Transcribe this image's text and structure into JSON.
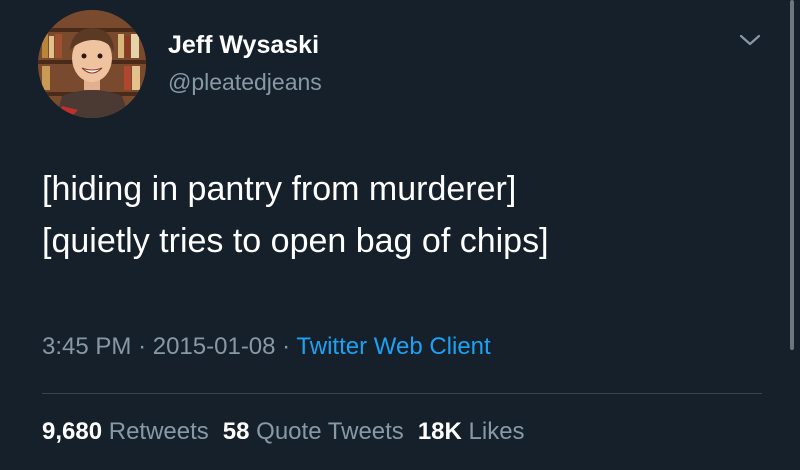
{
  "author": {
    "name": "Jeff Wysaski",
    "handle": "@pleatedjeans"
  },
  "tweet": {
    "lines": [
      "[hiding in pantry from murderer]",
      "[quietly tries to open bag of chips]"
    ]
  },
  "meta": {
    "time": "3:45 PM",
    "separator": "·",
    "date": "2015-01-08",
    "client": "Twitter Web Client"
  },
  "stats": {
    "retweets_count": "9,680",
    "retweets_label": "Retweets",
    "quotes_count": "58",
    "quotes_label": "Quote Tweets",
    "likes_count": "18K",
    "likes_label": "Likes"
  },
  "icons": {
    "menu": "chevron-down-icon"
  },
  "colors": {
    "background": "#15202b",
    "text": "#ffffff",
    "secondary": "#8899a6",
    "link": "#1da1f2",
    "divider": "#38444d"
  }
}
